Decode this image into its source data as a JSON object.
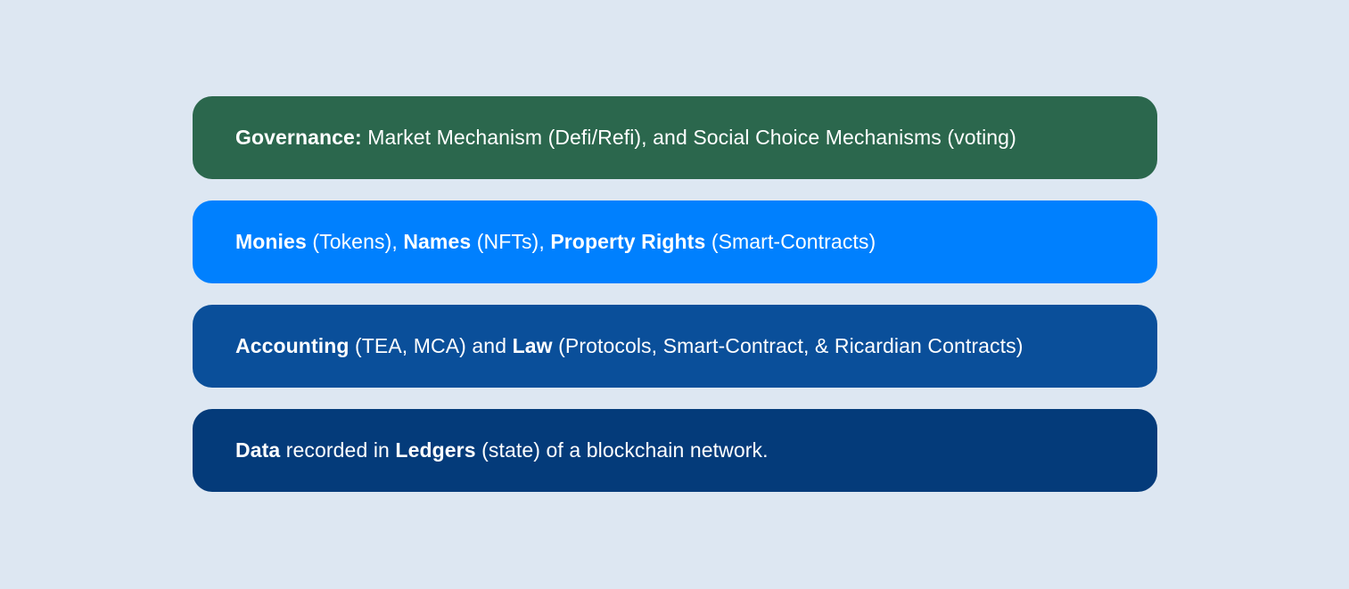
{
  "layers": [
    {
      "color": "#2b674d",
      "segments": [
        {
          "text": "Governance:",
          "bold": true
        },
        {
          "text": " Market Mechanism (Defi/Refi), and Social Choice Mechanisms (voting)",
          "bold": false
        }
      ]
    },
    {
      "color": "#0080fe",
      "segments": [
        {
          "text": "Monies",
          "bold": true
        },
        {
          "text": " (Tokens), ",
          "bold": false
        },
        {
          "text": "Names",
          "bold": true
        },
        {
          "text": " (NFTs), ",
          "bold": false
        },
        {
          "text": "Property Rights",
          "bold": true
        },
        {
          "text": " (Smart-Contracts)",
          "bold": false
        }
      ]
    },
    {
      "color": "#0a4f9a",
      "segments": [
        {
          "text": "Accounting",
          "bold": true
        },
        {
          "text": " (TEA, MCA) and ",
          "bold": false
        },
        {
          "text": "Law",
          "bold": true
        },
        {
          "text": " (Protocols, Smart-Contract, & Ricardian Contracts)",
          "bold": false
        }
      ]
    },
    {
      "color": "#043b7a",
      "segments": [
        {
          "text": "Data",
          "bold": true
        },
        {
          "text": " recorded in ",
          "bold": false
        },
        {
          "text": "Ledgers",
          "bold": true
        },
        {
          "text": " (state) of a blockchain network.",
          "bold": false
        }
      ]
    }
  ]
}
